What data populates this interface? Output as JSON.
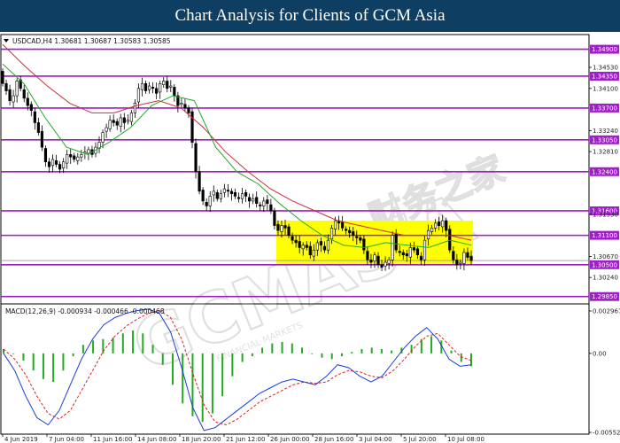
{
  "banner": {
    "title": "Chart Analysis for Clients of GCM Asia"
  },
  "colors": {
    "banner_bg": "#0e3f62",
    "level_line": "#9b1fbf",
    "level_label_bg": "#a020c8",
    "ma_fast": "#22aa22",
    "ma_slow": "#d22a3c",
    "zone_fill": "#ffff00",
    "candle": "#000000",
    "macd_hist": "#22aa22",
    "macd_main": "#1a3cdc",
    "macd_signal": "#e02020"
  },
  "watermark": {
    "text": "GCMASIA",
    "badge": "财务之家",
    "subtitle": "FINANCIAL MARKETS"
  },
  "chart_data": [
    {
      "type": "candlestick",
      "symbol_info": "USDCAD,H4  1.30681 1.30687 1.30583 1.30585",
      "current_price": 1.30585,
      "ylim": [
        1.297,
        1.352
      ],
      "y_tick_labels": [
        "1.34530",
        "1.34100",
        "1.33240",
        "1.32810",
        "1.31530",
        "1.30670",
        "1.30240"
      ],
      "x_tick_labels": [
        "4 Jun 2019",
        "7 Jun 04:00",
        "11 Jun 16:00",
        "14 Jun 08:00",
        "18 Jun 20:00",
        "21 Jun 12:00",
        "26 Jun 00:00",
        "28 Jun 16:00",
        "3 Jul 04:00",
        "5 Jul 20:00",
        "10 Jul 08:00"
      ],
      "levels": [
        1.349,
        1.3435,
        1.337,
        1.3305,
        1.324,
        1.316,
        1.311,
        1.305,
        1.2985
      ],
      "level_labels": [
        "1.34900",
        "1.34350",
        "1.33700",
        "1.33050",
        "1.32400",
        "1.31600",
        "1.31100",
        "1.30500",
        "1.29850"
      ],
      "zone": {
        "low": 1.305,
        "high": 1.314,
        "from_index": 77,
        "to_index": 131
      },
      "close": [
        1.342,
        1.3405,
        1.3385,
        1.3395,
        1.3425,
        1.341,
        1.339,
        1.3375,
        1.3365,
        1.334,
        1.332,
        1.329,
        1.326,
        1.325,
        1.3265,
        1.3255,
        1.3245,
        1.326,
        1.3275,
        1.327,
        1.3265,
        1.327,
        1.3275,
        1.328,
        1.3285,
        1.3275,
        1.329,
        1.33,
        1.332,
        1.333,
        1.3345,
        1.334,
        1.3335,
        1.335,
        1.334,
        1.3345,
        1.336,
        1.338,
        1.341,
        1.342,
        1.3405,
        1.3415,
        1.341,
        1.34,
        1.342,
        1.3425,
        1.341,
        1.3415,
        1.3395,
        1.3375,
        1.338,
        1.337,
        1.336,
        1.33,
        1.324,
        1.32,
        1.318,
        1.317,
        1.319,
        1.32,
        1.3185,
        1.3195,
        1.3205,
        1.32,
        1.3195,
        1.319,
        1.3185,
        1.3195,
        1.319,
        1.318,
        1.3185,
        1.3175,
        1.317,
        1.318,
        1.3175,
        1.316,
        1.313,
        1.312,
        1.313,
        1.3125,
        1.311,
        1.31,
        1.3095,
        1.3085,
        1.309,
        1.3085,
        1.307,
        1.308,
        1.3095,
        1.309,
        1.308,
        1.31,
        1.3125,
        1.314,
        1.3135,
        1.3125,
        1.312,
        1.3115,
        1.311,
        1.3105,
        1.31,
        1.308,
        1.306,
        1.3055,
        1.307,
        1.305,
        1.3045,
        1.3055,
        1.306,
        1.311,
        1.308,
        1.3075,
        1.307,
        1.3068,
        1.3085,
        1.308,
        1.307,
        1.306,
        1.31,
        1.312,
        1.3125,
        1.3135,
        1.313,
        1.314,
        1.312,
        1.308,
        1.306,
        1.305,
        1.3055,
        1.3075,
        1.3065,
        1.30585
      ],
      "ma_fast": [
        1.346,
        1.342,
        1.335,
        1.329,
        1.3275,
        1.33,
        1.333,
        1.3375,
        1.3395,
        1.3385,
        1.329,
        1.324,
        1.3215,
        1.3175,
        1.314,
        1.311,
        1.309,
        1.3085,
        1.3095,
        1.309,
        1.3085,
        1.31,
        1.309
      ],
      "ma_slow": [
        1.35,
        1.3455,
        1.3415,
        1.338,
        1.336,
        1.336,
        1.3375,
        1.3385,
        1.337,
        1.333,
        1.328,
        1.324,
        1.3205,
        1.318,
        1.316,
        1.314,
        1.313,
        1.312,
        1.311,
        1.311,
        1.311,
        1.31
      ]
    },
    {
      "type": "bar",
      "label": "MACD(12,26,9) -0.000934 -0.000466 -0.000468",
      "y_tick_labels": [
        "0.002967",
        "0.00",
        "-0.005529"
      ],
      "ylim": [
        -0.005529,
        0.002967
      ],
      "histogram": [
        0.0003,
        0.0,
        -0.0005,
        -0.0012,
        -0.0018,
        -0.002,
        -0.0012,
        -0.0002,
        0.0006,
        0.0009,
        0.001,
        0.0011,
        0.0014,
        0.0016,
        0.0014,
        0.0006,
        -0.0008,
        -0.0022,
        -0.0035,
        -0.0044,
        -0.0048,
        -0.0042,
        -0.003,
        -0.0016,
        -0.0006,
        -0.0002,
        0.0004,
        0.0007,
        0.0008,
        0.0007,
        0.0004,
        0.0,
        -0.0003,
        -0.0004,
        -0.0002,
        0.0001,
        0.0003,
        0.0004,
        0.0003,
        0.0002,
        0.0004,
        0.0006,
        0.001,
        0.0012,
        0.0009,
        0.0002,
        -0.0006,
        -0.0009
      ],
      "macd_main": [
        0.0,
        -0.0012,
        -0.003,
        -0.0045,
        -0.005,
        -0.004,
        -0.0022,
        -0.0004,
        0.001,
        0.002,
        0.0025,
        0.0028,
        0.003,
        0.0031,
        0.0028,
        0.0015,
        -0.001,
        -0.0038,
        -0.0054,
        -0.0052,
        -0.0046,
        -0.004,
        -0.0034,
        -0.0028,
        -0.0024,
        -0.002,
        -0.0018,
        -0.002,
        -0.0022,
        -0.0016,
        -0.0008,
        -0.001,
        -0.0016,
        -0.002,
        -0.0016,
        -0.0006,
        0.0004,
        0.0012,
        0.0018,
        0.001,
        -0.0004,
        -0.0009,
        -0.0008
      ],
      "macd_signal": [
        0.0003,
        -0.0004,
        -0.0015,
        -0.003,
        -0.0042,
        -0.0046,
        -0.004,
        -0.0026,
        -0.0012,
        0.0002,
        0.0012,
        0.0019,
        0.0024,
        0.0028,
        0.003,
        0.0025,
        0.001,
        -0.0014,
        -0.0036,
        -0.0048,
        -0.005,
        -0.0046,
        -0.004,
        -0.0034,
        -0.003,
        -0.0026,
        -0.0022,
        -0.002,
        -0.0021,
        -0.002,
        -0.0015,
        -0.0012,
        -0.0013,
        -0.0016,
        -0.0017,
        -0.0012,
        -0.0004,
        0.0005,
        0.0012,
        0.0014,
        0.0006,
        -0.0002,
        -0.0005
      ]
    }
  ]
}
